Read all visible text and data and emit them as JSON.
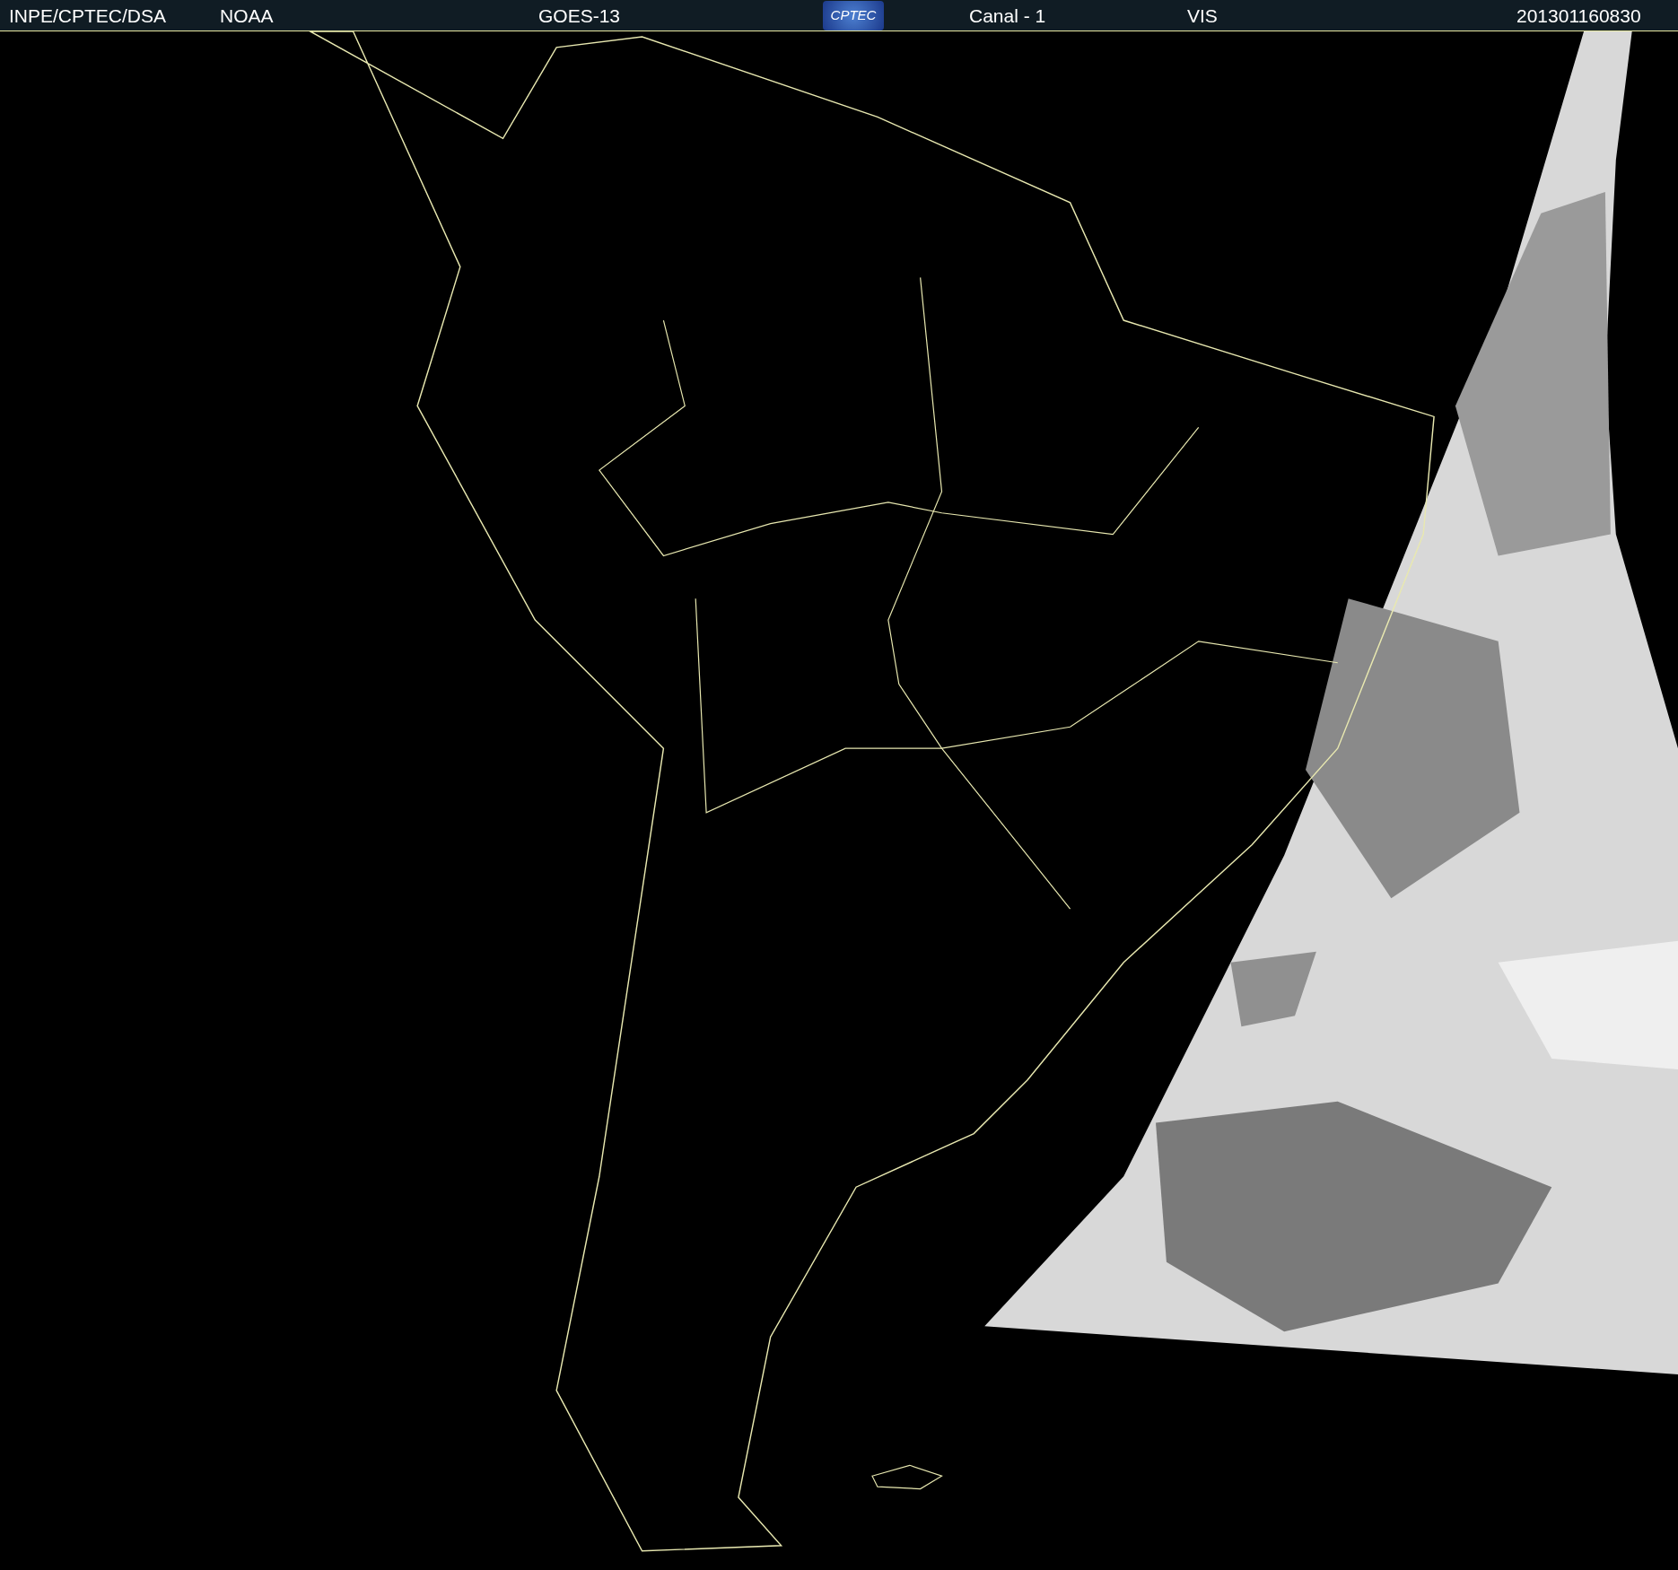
{
  "header": {
    "items": [
      {
        "kind": "text",
        "text": "INPE/CPTEC/DSA"
      },
      {
        "kind": "text",
        "text": "NOAA"
      },
      {
        "kind": "text",
        "text": "GOES-13"
      },
      {
        "kind": "logo",
        "text": "CPTEC"
      },
      {
        "kind": "text",
        "text": "Canal - 1"
      },
      {
        "kind": "text",
        "text": "VIS"
      },
      {
        "kind": "text",
        "text": "201301160830"
      }
    ]
  }
}
